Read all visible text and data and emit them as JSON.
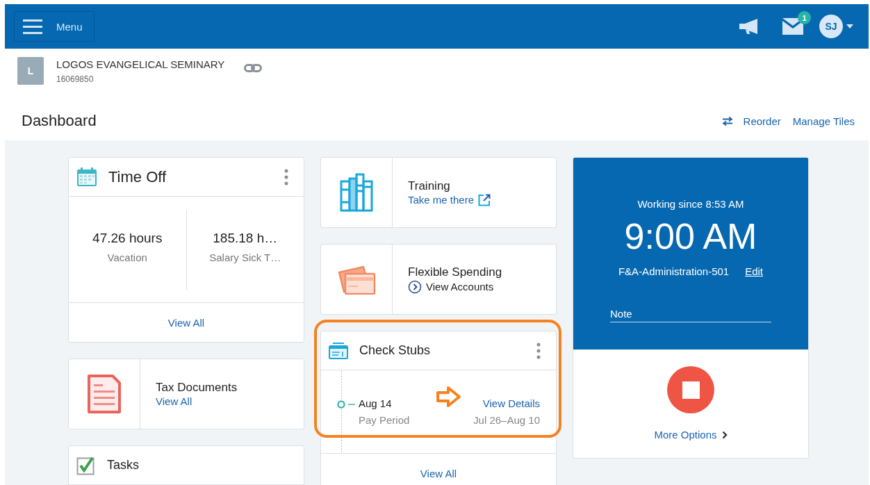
{
  "top_bar": {
    "menu_label": "Menu",
    "mail_badge": "1",
    "avatar_initials": "SJ"
  },
  "organization": {
    "initial": "L",
    "name": "LOGOS EVANGELICAL SEMINARY",
    "number": "16069850"
  },
  "page": {
    "title": "Dashboard",
    "actions": [
      "Reorder",
      "Manage Tiles"
    ]
  },
  "time_off": {
    "title": "Time Off",
    "balances": [
      {
        "amount": "47.26 hours",
        "label": "Vacation"
      },
      {
        "amount": "185.18 h…",
        "label": "Salary Sick T…"
      }
    ],
    "footer_link": "View All"
  },
  "tax_documents": {
    "title": "Tax Documents",
    "link": "View All"
  },
  "tasks": {
    "title": "Tasks"
  },
  "training": {
    "title": "Training",
    "link": "Take me there"
  },
  "flexible_spending": {
    "title": "Flexible Spending",
    "link": "View Accounts"
  },
  "check_stubs": {
    "title": "Check Stubs",
    "entries": [
      {
        "date": "Aug 14",
        "caption": "Pay Period",
        "link": "View Details",
        "range": "Jul 26–Aug 10"
      }
    ],
    "footer_link": "View All",
    "highlighted": true
  },
  "clock": {
    "status": "Working since 8:53 AM",
    "time": "9:00 AM",
    "job": "F&A-Administration-501",
    "edit_link": "Edit",
    "note": {
      "placeholder": "Note"
    },
    "more_options": "More Options"
  }
}
